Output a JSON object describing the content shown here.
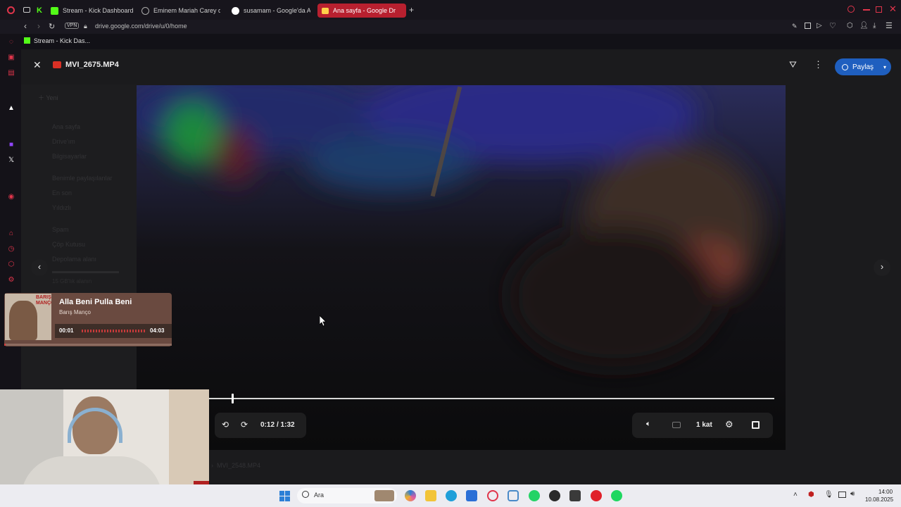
{
  "browser": {
    "tabs": [
      {
        "label": "Stream - Kick Dashboard",
        "color": "#53fc18"
      },
      {
        "label": "Eminem Mariah Carey di",
        "color": "#aaaaaa"
      },
      {
        "label": "susamam - Google'da Ar",
        "color": "#ffffff"
      },
      {
        "label": "Ana sayfa - Google Dr",
        "color": "#ffd04a",
        "active": true
      }
    ],
    "vpn_badge": "VPN",
    "url": "drive.google.com/drive/u/0/home",
    "bookmark": "Stream - Kick Das..."
  },
  "viewer": {
    "file_name": "MVI_2675.MP4",
    "share_label": "Paylaş",
    "time_current": "0:12",
    "time_total": "/ 1:32",
    "speed_label": "1 kat",
    "progress": 0.04
  },
  "drive_bg": {
    "new_label": "Yeni",
    "nav": [
      "Ana sayfa",
      "Drive'ım",
      "Bilgisayarlar",
      "Benimle paylaşılanlar",
      "En son",
      "Yıldızlı",
      "Spam",
      "Çöp Kutusu",
      "Depolama alanı"
    ],
    "breadcrumb": "MVI_2548.MP4",
    "storage": "15 GB'lık alanın"
  },
  "music": {
    "title": "Alla Beni Pulla Beni",
    "artist": "Barış Manço",
    "elapsed": "00:01",
    "duration": "04:03",
    "progress": 0.004,
    "cover_text": "BARIŞ MANÇO"
  },
  "taskbar": {
    "search_label": "Ara",
    "time": "14:00",
    "date": "10.08.2025"
  },
  "colors": {
    "accent_red": "#e0354b",
    "share_blue": "#1f5fbf",
    "music_bg": "#6a4a40"
  }
}
